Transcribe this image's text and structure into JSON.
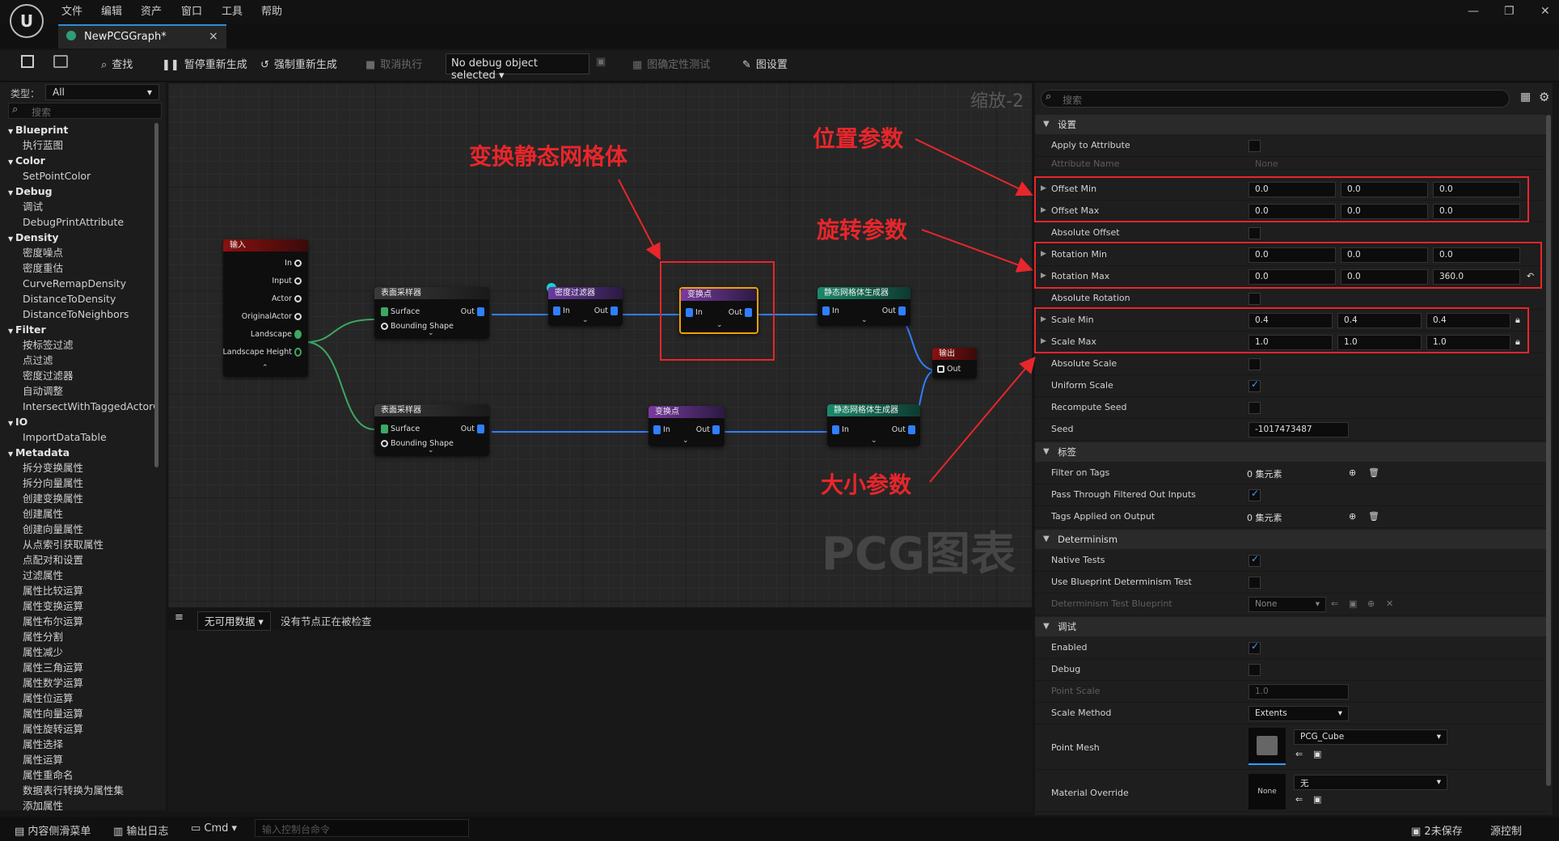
{
  "menu": [
    "文件",
    "编辑",
    "资产",
    "窗口",
    "工具",
    "帮助"
  ],
  "window_controls": {
    "minimize": "—",
    "maximize": "❐",
    "close": "✕"
  },
  "tab": {
    "title": "NewPCGGraph*",
    "close": "×"
  },
  "toolbar": {
    "find": "查找",
    "pause_regen": "暂停重新生成",
    "force_regen": "强制重新生成",
    "cancel_exec": "取消执行",
    "debug_object": "No debug object selected",
    "determinism_test": "图确定性测试",
    "graph_settings": "图设置"
  },
  "palette": {
    "type_label": "类型：",
    "type_value": "All",
    "search_placeholder": "搜索",
    "items": [
      {
        "t": "Blueprint",
        "cat": true
      },
      {
        "t": "执行蓝图"
      },
      {
        "t": "Color",
        "cat": true
      },
      {
        "t": "SetPointColor"
      },
      {
        "t": "Debug",
        "cat": true
      },
      {
        "t": "调试"
      },
      {
        "t": "DebugPrintAttribute"
      },
      {
        "t": "Density",
        "cat": true
      },
      {
        "t": "密度噪点"
      },
      {
        "t": "密度重估"
      },
      {
        "t": "CurveRemapDensity"
      },
      {
        "t": "DistanceToDensity"
      },
      {
        "t": "DistanceToNeighbors"
      },
      {
        "t": "Filter",
        "cat": true
      },
      {
        "t": "按标签过滤"
      },
      {
        "t": "点过滤"
      },
      {
        "t": "密度过滤器"
      },
      {
        "t": "自动调整"
      },
      {
        "t": "IntersectWithTaggedActorG"
      },
      {
        "t": "IO",
        "cat": true
      },
      {
        "t": "ImportDataTable"
      },
      {
        "t": "Metadata",
        "cat": true
      },
      {
        "t": "拆分变换属性"
      },
      {
        "t": "拆分向量属性"
      },
      {
        "t": "创建变换属性"
      },
      {
        "t": "创建属性"
      },
      {
        "t": "创建向量属性"
      },
      {
        "t": "从点索引获取属性"
      },
      {
        "t": "点配对和设置"
      },
      {
        "t": "过滤属性"
      },
      {
        "t": "属性比较运算"
      },
      {
        "t": "属性变换运算"
      },
      {
        "t": "属性布尔运算"
      },
      {
        "t": "属性分割"
      },
      {
        "t": "属性减少"
      },
      {
        "t": "属性三角运算"
      },
      {
        "t": "属性数学运算"
      },
      {
        "t": "属性位运算"
      },
      {
        "t": "属性向量运算"
      },
      {
        "t": "属性旋转运算"
      },
      {
        "t": "属性选择"
      },
      {
        "t": "属性运算"
      },
      {
        "t": "属性重命名"
      },
      {
        "t": "数据表行转换为属性集"
      },
      {
        "t": "添加属性"
      }
    ]
  },
  "graph": {
    "zoom": "缩放-2",
    "watermark": "PCG图表",
    "input_node": {
      "title": "输入",
      "pins": [
        "In",
        "Input",
        "Actor",
        "OriginalActor",
        "Landscape",
        "Landscape Height"
      ]
    },
    "surface_sampler_title": "表面采样器",
    "surface_pins": {
      "surface": "Surface",
      "bounding": "Bounding Shape",
      "out": "Out"
    },
    "density_filter_title": "密度过滤器",
    "transform_title": "变换点",
    "static_mesh_title": "静态网格体生成器",
    "output_title": "输出",
    "pin_in": "In",
    "pin_out": "Out"
  },
  "console": {
    "filter_label": "无可用数据",
    "status": "没有节点正在被检查"
  },
  "statusbar": {
    "content_drawer": "内容侧滑菜单",
    "output_log": "输出日志",
    "cmd": "Cmd",
    "cmd_placeholder": "输入控制台命令",
    "unsaved": "2未保存",
    "source_control": "源控制"
  },
  "details": {
    "search_placeholder": "搜索",
    "sections": {
      "settings": "设置",
      "tags": "标签",
      "determinism": "Determinism",
      "debug": "调试"
    },
    "rows": {
      "apply_to_attribute": "Apply to Attribute",
      "attribute_name": "Attribute Name",
      "attribute_name_value": "None",
      "offset_min": "Offset Min",
      "offset_min_values": [
        "0.0",
        "0.0",
        "0.0"
      ],
      "offset_max": "Offset Max",
      "offset_max_values": [
        "0.0",
        "0.0",
        "0.0"
      ],
      "absolute_offset": "Absolute Offset",
      "rotation_min": "Rotation Min",
      "rotation_min_values": [
        "0.0",
        "0.0",
        "0.0"
      ],
      "rotation_max": "Rotation Max",
      "rotation_max_values": [
        "0.0",
        "0.0",
        "360.0"
      ],
      "absolute_rotation": "Absolute Rotation",
      "scale_min": "Scale Min",
      "scale_min_values": [
        "0.4",
        "0.4",
        "0.4"
      ],
      "scale_max": "Scale Max",
      "scale_max_values": [
        "1.0",
        "1.0",
        "1.0"
      ],
      "absolute_scale": "Absolute Scale",
      "uniform_scale": "Uniform Scale",
      "recompute_seed": "Recompute Seed",
      "seed": "Seed",
      "seed_value": "-1017473487",
      "filter_on_tags": "Filter on Tags",
      "filter_on_tags_value": "0 集元素",
      "pass_through": "Pass Through Filtered Out Inputs",
      "tags_applied": "Tags Applied on Output",
      "tags_applied_value": "0 集元素",
      "native_tests": "Native Tests",
      "use_bp_test": "Use Blueprint Determinism Test",
      "det_test_bp": "Determinism Test Blueprint",
      "det_test_bp_value": "None",
      "enabled": "Enabled",
      "debug": "Debug",
      "point_scale": "Point Scale",
      "point_scale_value": "1.0",
      "scale_method": "Scale Method",
      "scale_method_value": "Extents",
      "point_mesh": "Point Mesh",
      "point_mesh_value": "PCG_Cube",
      "material_override": "Material Override",
      "material_override_value": "无",
      "material_thumb": "None"
    }
  },
  "annotations": {
    "transform_mesh": "变换静态网格体",
    "position_params": "位置参数",
    "rotation_params": "旋转参数",
    "scale_params": "大小参数"
  },
  "colors": {
    "accent": "#2f7fff",
    "annotation_red": "#e8262b",
    "selected_node": "#f0a000"
  }
}
